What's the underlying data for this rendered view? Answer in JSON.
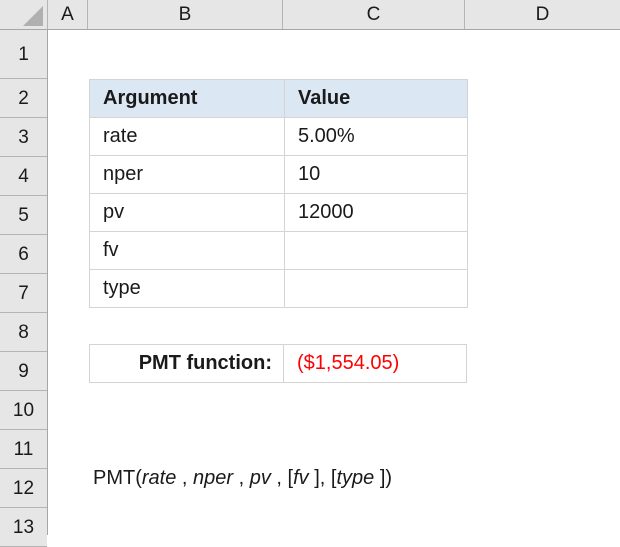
{
  "spreadsheet": {
    "column_headers": [
      "A",
      "B",
      "C",
      "D"
    ],
    "row_headers": [
      "1",
      "2",
      "3",
      "4",
      "5",
      "6",
      "7",
      "8",
      "9",
      "10",
      "11",
      "12",
      "13"
    ],
    "select_all_corner": "select-all-triangle"
  },
  "argument_table": {
    "headers": {
      "argument": "Argument",
      "value": "Value"
    },
    "rows": [
      {
        "argument": "rate",
        "value": "5.00%"
      },
      {
        "argument": "nper",
        "value": "10"
      },
      {
        "argument": "pv",
        "value": "12000"
      },
      {
        "argument": "fv",
        "value": ""
      },
      {
        "argument": "type",
        "value": ""
      }
    ],
    "header_fill": "#dbe8f4",
    "border_color": "#d4d4d4"
  },
  "result": {
    "label": "PMT function:",
    "value": "($1,554.05)",
    "value_color": "#ff0000"
  },
  "syntax": {
    "function_open": "PMT(",
    "arg_rate": "rate",
    "sep_1": " , ",
    "arg_nper": "nper",
    "sep_2": " , ",
    "arg_pv": "pv",
    "sep_3": " , [",
    "arg_fv": "fv",
    "sep_4": " ], [",
    "arg_type": "type",
    "close": " ])",
    "full_text": "PMT(rate , nper , pv , [fv ], [type ])"
  }
}
